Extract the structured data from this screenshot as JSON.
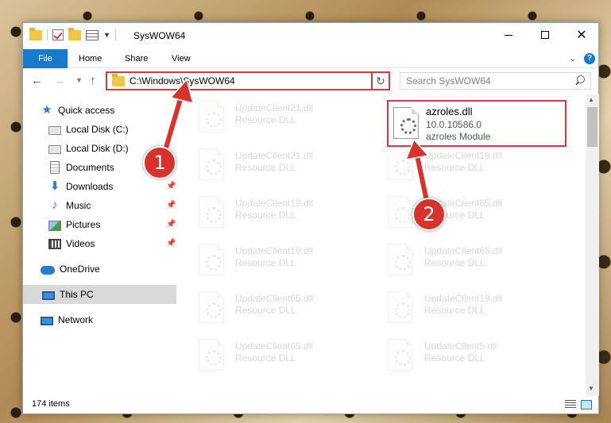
{
  "window": {
    "title": "SysWOW64",
    "colors": {
      "accent": "#1979ca",
      "highlight": "#d9393f",
      "callout": "#d7332d"
    }
  },
  "ribbon": {
    "tabs": [
      {
        "label": "File"
      },
      {
        "label": "Home"
      },
      {
        "label": "Share"
      },
      {
        "label": "View"
      }
    ],
    "help_glyph": "?"
  },
  "navigation": {
    "address": "C:\\Windows\\SysWOW64",
    "search_placeholder": "Search SysWOW64"
  },
  "sidebar": {
    "items": [
      {
        "label": "Quick access",
        "icon": "star-icon"
      },
      {
        "label": "Local Disk (C:)",
        "icon": "drive-icon",
        "pinned": true
      },
      {
        "label": "Local Disk (D:)",
        "icon": "drive-icon",
        "pinned": true
      },
      {
        "label": "Documents",
        "icon": "documents-icon",
        "pinned": true
      },
      {
        "label": "Downloads",
        "icon": "download-icon",
        "pinned": true
      },
      {
        "label": "Music",
        "icon": "music-icon",
        "pinned": true
      },
      {
        "label": "Pictures",
        "icon": "pictures-icon",
        "pinned": true
      },
      {
        "label": "Videos",
        "icon": "videos-icon",
        "pinned": true
      },
      {
        "label": "OneDrive",
        "icon": "cloud-icon"
      },
      {
        "label": "This PC",
        "icon": "computer-icon",
        "selected": true
      },
      {
        "label": "Network",
        "icon": "network-icon"
      }
    ]
  },
  "files": {
    "highlighted": {
      "name": "azroles.dll",
      "version": "10.0.10586.0",
      "description": "azroles Module"
    },
    "left_column": [
      {
        "name": "UpdateClient21.dll",
        "type": "Resource DLL"
      },
      {
        "name": "UpdateClient21.dll",
        "type": "Resource DLL"
      },
      {
        "name": "UpdateClient19.dll",
        "type": "Resource DLL"
      },
      {
        "name": "UpdateClient19.dll",
        "type": "Resource DLL"
      },
      {
        "name": "UpdateClient65.dll",
        "type": "Resource DLL"
      },
      {
        "name": "UpdateClient65.dll",
        "type": "Resource DLL"
      }
    ],
    "right_column": [
      {
        "name": "UpdateClient19.dll",
        "type": "Resource DLL"
      },
      {
        "name": "UpdateClient65.dll",
        "type": "Resource DLL"
      },
      {
        "name": "UpdateClient65.dll",
        "type": "Resource DLL"
      },
      {
        "name": "UpdateClient19.dll",
        "type": "Resource DLL"
      },
      {
        "name": "UpdateClient5.dll",
        "type": "Resource DLL"
      }
    ]
  },
  "status": {
    "item_count": "174 items"
  },
  "callouts": [
    {
      "number": "1"
    },
    {
      "number": "2"
    }
  ]
}
